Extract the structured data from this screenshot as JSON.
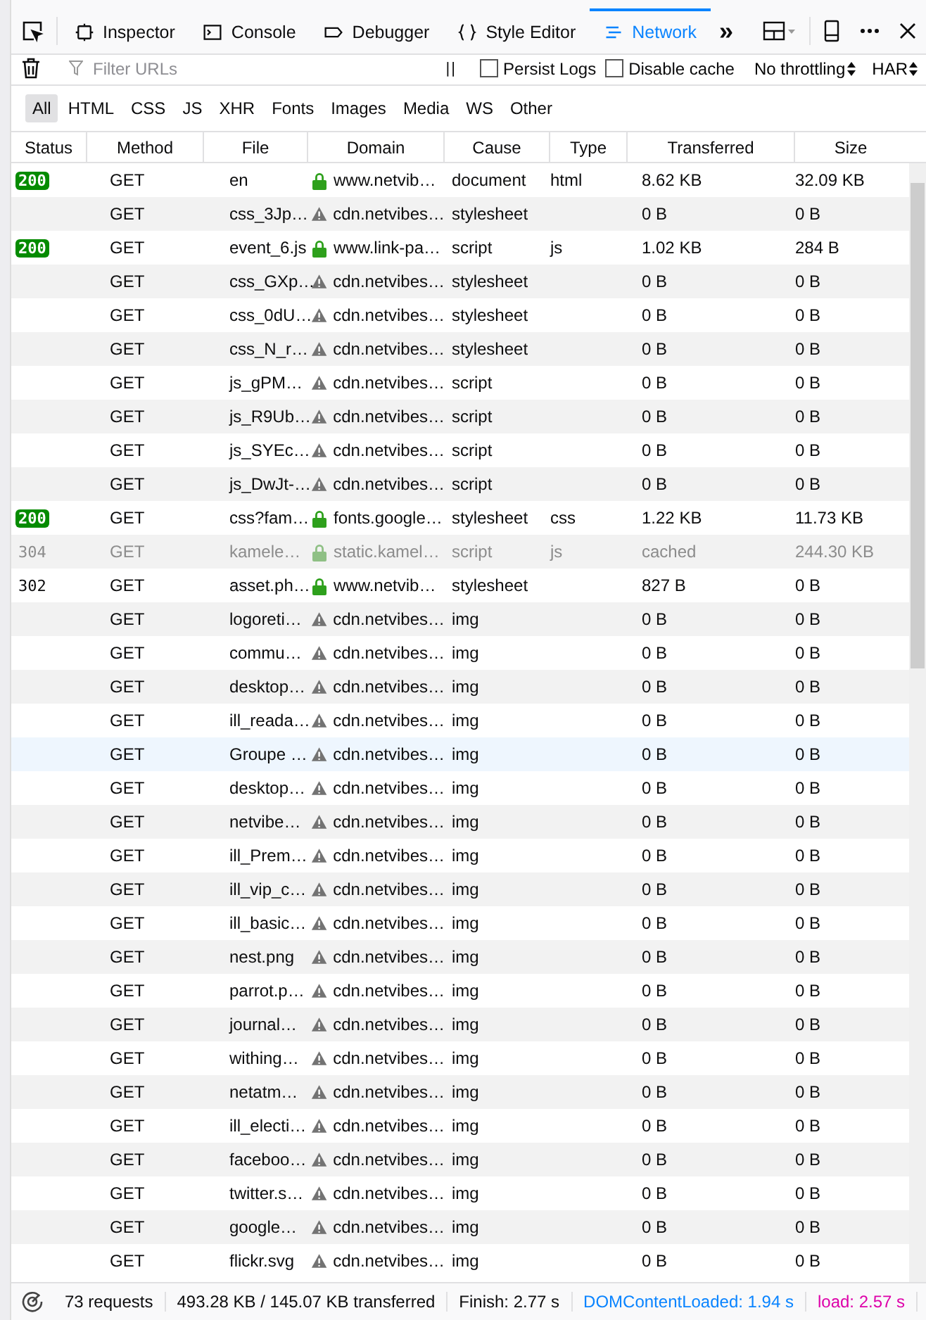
{
  "toolbar": {
    "tabs": [
      {
        "label": "Inspector",
        "selected": false
      },
      {
        "label": "Console",
        "selected": false
      },
      {
        "label": "Debugger",
        "selected": false
      },
      {
        "label": "Style Editor",
        "selected": false
      },
      {
        "label": "Network",
        "selected": true
      }
    ],
    "overflow": "»"
  },
  "filter_bar": {
    "placeholder": "Filter URLs",
    "pause": "| |",
    "persist_logs": {
      "label": "Persist Logs",
      "checked": false
    },
    "disable_cache": {
      "label": "Disable cache",
      "checked": false
    },
    "throttling": "No throttling",
    "har": "HAR"
  },
  "type_filters": [
    {
      "label": "All",
      "selected": true
    },
    {
      "label": "HTML",
      "selected": false
    },
    {
      "label": "CSS",
      "selected": false
    },
    {
      "label": "JS",
      "selected": false
    },
    {
      "label": "XHR",
      "selected": false
    },
    {
      "label": "Fonts",
      "selected": false
    },
    {
      "label": "Images",
      "selected": false
    },
    {
      "label": "Media",
      "selected": false
    },
    {
      "label": "WS",
      "selected": false
    },
    {
      "label": "Other",
      "selected": false
    }
  ],
  "table": {
    "columns": [
      "Status",
      "Method",
      "File",
      "Domain",
      "Cause",
      "Type",
      "Transferred",
      "Size"
    ],
    "rows": [
      {
        "status": "200",
        "kind": "badge",
        "method": "GET",
        "file": "en",
        "secure": true,
        "domain": "www.netvib…",
        "cause": "document",
        "type": "html",
        "transferred": "8.62 KB",
        "size": "32.09 KB",
        "cached": false,
        "selected": false
      },
      {
        "method": "GET",
        "file": "css_3Jp…",
        "secure": false,
        "domain": "cdn.netvibes…",
        "cause": "stylesheet",
        "transferred": "0 B",
        "size": "0 B",
        "cached": false,
        "selected": false
      },
      {
        "status": "200",
        "kind": "badge",
        "method": "GET",
        "file": "event_6.js",
        "secure": true,
        "domain": "www.link-pa…",
        "cause": "script",
        "type": "js",
        "transferred": "1.02 KB",
        "size": "284 B",
        "cached": false,
        "selected": false
      },
      {
        "method": "GET",
        "file": "css_GXp…",
        "secure": false,
        "domain": "cdn.netvibes…",
        "cause": "stylesheet",
        "transferred": "0 B",
        "size": "0 B",
        "cached": false,
        "selected": false
      },
      {
        "method": "GET",
        "file": "css_0dU…",
        "secure": false,
        "domain": "cdn.netvibes…",
        "cause": "stylesheet",
        "transferred": "0 B",
        "size": "0 B",
        "cached": false,
        "selected": false
      },
      {
        "method": "GET",
        "file": "css_N_r…",
        "secure": false,
        "domain": "cdn.netvibes…",
        "cause": "stylesheet",
        "transferred": "0 B",
        "size": "0 B",
        "cached": false,
        "selected": false
      },
      {
        "method": "GET",
        "file": "js_gPM…",
        "secure": false,
        "domain": "cdn.netvibes…",
        "cause": "script",
        "transferred": "0 B",
        "size": "0 B",
        "cached": false,
        "selected": false
      },
      {
        "method": "GET",
        "file": "js_R9Ub…",
        "secure": false,
        "domain": "cdn.netvibes…",
        "cause": "script",
        "transferred": "0 B",
        "size": "0 B",
        "cached": false,
        "selected": false
      },
      {
        "method": "GET",
        "file": "js_SYEc…",
        "secure": false,
        "domain": "cdn.netvibes…",
        "cause": "script",
        "transferred": "0 B",
        "size": "0 B",
        "cached": false,
        "selected": false
      },
      {
        "method": "GET",
        "file": "js_DwJt-…",
        "secure": false,
        "domain": "cdn.netvibes…",
        "cause": "script",
        "transferred": "0 B",
        "size": "0 B",
        "cached": false,
        "selected": false
      },
      {
        "status": "200",
        "kind": "badge",
        "method": "GET",
        "file": "css?fam…",
        "secure": true,
        "domain": "fonts.google…",
        "cause": "stylesheet",
        "type": "css",
        "transferred": "1.22 KB",
        "size": "11.73 KB",
        "cached": false,
        "selected": false
      },
      {
        "status": "304",
        "kind": "plain",
        "method": "GET",
        "file": "kamele…",
        "secure": true,
        "domain": "static.kamel…",
        "cause": "script",
        "type": "js",
        "transferred": "cached",
        "size": "244.30 KB",
        "cached": true,
        "selected": false
      },
      {
        "status": "302",
        "kind": "plain",
        "method": "GET",
        "file": "asset.ph…",
        "secure": true,
        "domain": "www.netvib…",
        "cause": "stylesheet",
        "transferred": "827 B",
        "size": "0 B",
        "cached": false,
        "selected": false
      },
      {
        "method": "GET",
        "file": "logoreti…",
        "secure": false,
        "domain": "cdn.netvibes…",
        "cause": "img",
        "transferred": "0 B",
        "size": "0 B",
        "cached": false,
        "selected": false
      },
      {
        "method": "GET",
        "file": "commu…",
        "secure": false,
        "domain": "cdn.netvibes…",
        "cause": "img",
        "transferred": "0 B",
        "size": "0 B",
        "cached": false,
        "selected": false
      },
      {
        "method": "GET",
        "file": "desktop…",
        "secure": false,
        "domain": "cdn.netvibes…",
        "cause": "img",
        "transferred": "0 B",
        "size": "0 B",
        "cached": false,
        "selected": false
      },
      {
        "method": "GET",
        "file": "ill_reada…",
        "secure": false,
        "domain": "cdn.netvibes…",
        "cause": "img",
        "transferred": "0 B",
        "size": "0 B",
        "cached": false,
        "selected": false
      },
      {
        "method": "GET",
        "file": "Groupe …",
        "secure": false,
        "domain": "cdn.netvibes…",
        "cause": "img",
        "transferred": "0 B",
        "size": "0 B",
        "cached": false,
        "selected": true
      },
      {
        "method": "GET",
        "file": "desktop…",
        "secure": false,
        "domain": "cdn.netvibes…",
        "cause": "img",
        "transferred": "0 B",
        "size": "0 B",
        "cached": false,
        "selected": false
      },
      {
        "method": "GET",
        "file": "netvibe…",
        "secure": false,
        "domain": "cdn.netvibes…",
        "cause": "img",
        "transferred": "0 B",
        "size": "0 B",
        "cached": false,
        "selected": false
      },
      {
        "method": "GET",
        "file": "ill_Prem…",
        "secure": false,
        "domain": "cdn.netvibes…",
        "cause": "img",
        "transferred": "0 B",
        "size": "0 B",
        "cached": false,
        "selected": false
      },
      {
        "method": "GET",
        "file": "ill_vip_c…",
        "secure": false,
        "domain": "cdn.netvibes…",
        "cause": "img",
        "transferred": "0 B",
        "size": "0 B",
        "cached": false,
        "selected": false
      },
      {
        "method": "GET",
        "file": "ill_basic…",
        "secure": false,
        "domain": "cdn.netvibes…",
        "cause": "img",
        "transferred": "0 B",
        "size": "0 B",
        "cached": false,
        "selected": false
      },
      {
        "method": "GET",
        "file": "nest.png",
        "secure": false,
        "domain": "cdn.netvibes…",
        "cause": "img",
        "transferred": "0 B",
        "size": "0 B",
        "cached": false,
        "selected": false
      },
      {
        "method": "GET",
        "file": "parrot.p…",
        "secure": false,
        "domain": "cdn.netvibes…",
        "cause": "img",
        "transferred": "0 B",
        "size": "0 B",
        "cached": false,
        "selected": false
      },
      {
        "method": "GET",
        "file": "journal…",
        "secure": false,
        "domain": "cdn.netvibes…",
        "cause": "img",
        "transferred": "0 B",
        "size": "0 B",
        "cached": false,
        "selected": false
      },
      {
        "method": "GET",
        "file": "withing…",
        "secure": false,
        "domain": "cdn.netvibes…",
        "cause": "img",
        "transferred": "0 B",
        "size": "0 B",
        "cached": false,
        "selected": false
      },
      {
        "method": "GET",
        "file": "netatm…",
        "secure": false,
        "domain": "cdn.netvibes…",
        "cause": "img",
        "transferred": "0 B",
        "size": "0 B",
        "cached": false,
        "selected": false
      },
      {
        "method": "GET",
        "file": "ill_electi…",
        "secure": false,
        "domain": "cdn.netvibes…",
        "cause": "img",
        "transferred": "0 B",
        "size": "0 B",
        "cached": false,
        "selected": false
      },
      {
        "method": "GET",
        "file": "faceboo…",
        "secure": false,
        "domain": "cdn.netvibes…",
        "cause": "img",
        "transferred": "0 B",
        "size": "0 B",
        "cached": false,
        "selected": false
      },
      {
        "method": "GET",
        "file": "twitter.s…",
        "secure": false,
        "domain": "cdn.netvibes…",
        "cause": "img",
        "transferred": "0 B",
        "size": "0 B",
        "cached": false,
        "selected": false
      },
      {
        "method": "GET",
        "file": "google…",
        "secure": false,
        "domain": "cdn.netvibes…",
        "cause": "img",
        "transferred": "0 B",
        "size": "0 B",
        "cached": false,
        "selected": false
      },
      {
        "method": "GET",
        "file": "flickr.svg",
        "secure": false,
        "domain": "cdn.netvibes…",
        "cause": "img",
        "transferred": "0 B",
        "size": "0 B",
        "cached": false,
        "selected": false
      }
    ]
  },
  "status_bar": {
    "requests": "73 requests",
    "transferred": "493.28 KB / 145.07 KB transferred",
    "finish": "Finish: 2.77 s",
    "dom_content_loaded": "DOMContentLoaded: 1.94 s",
    "load": "load: 2.57 s"
  }
}
